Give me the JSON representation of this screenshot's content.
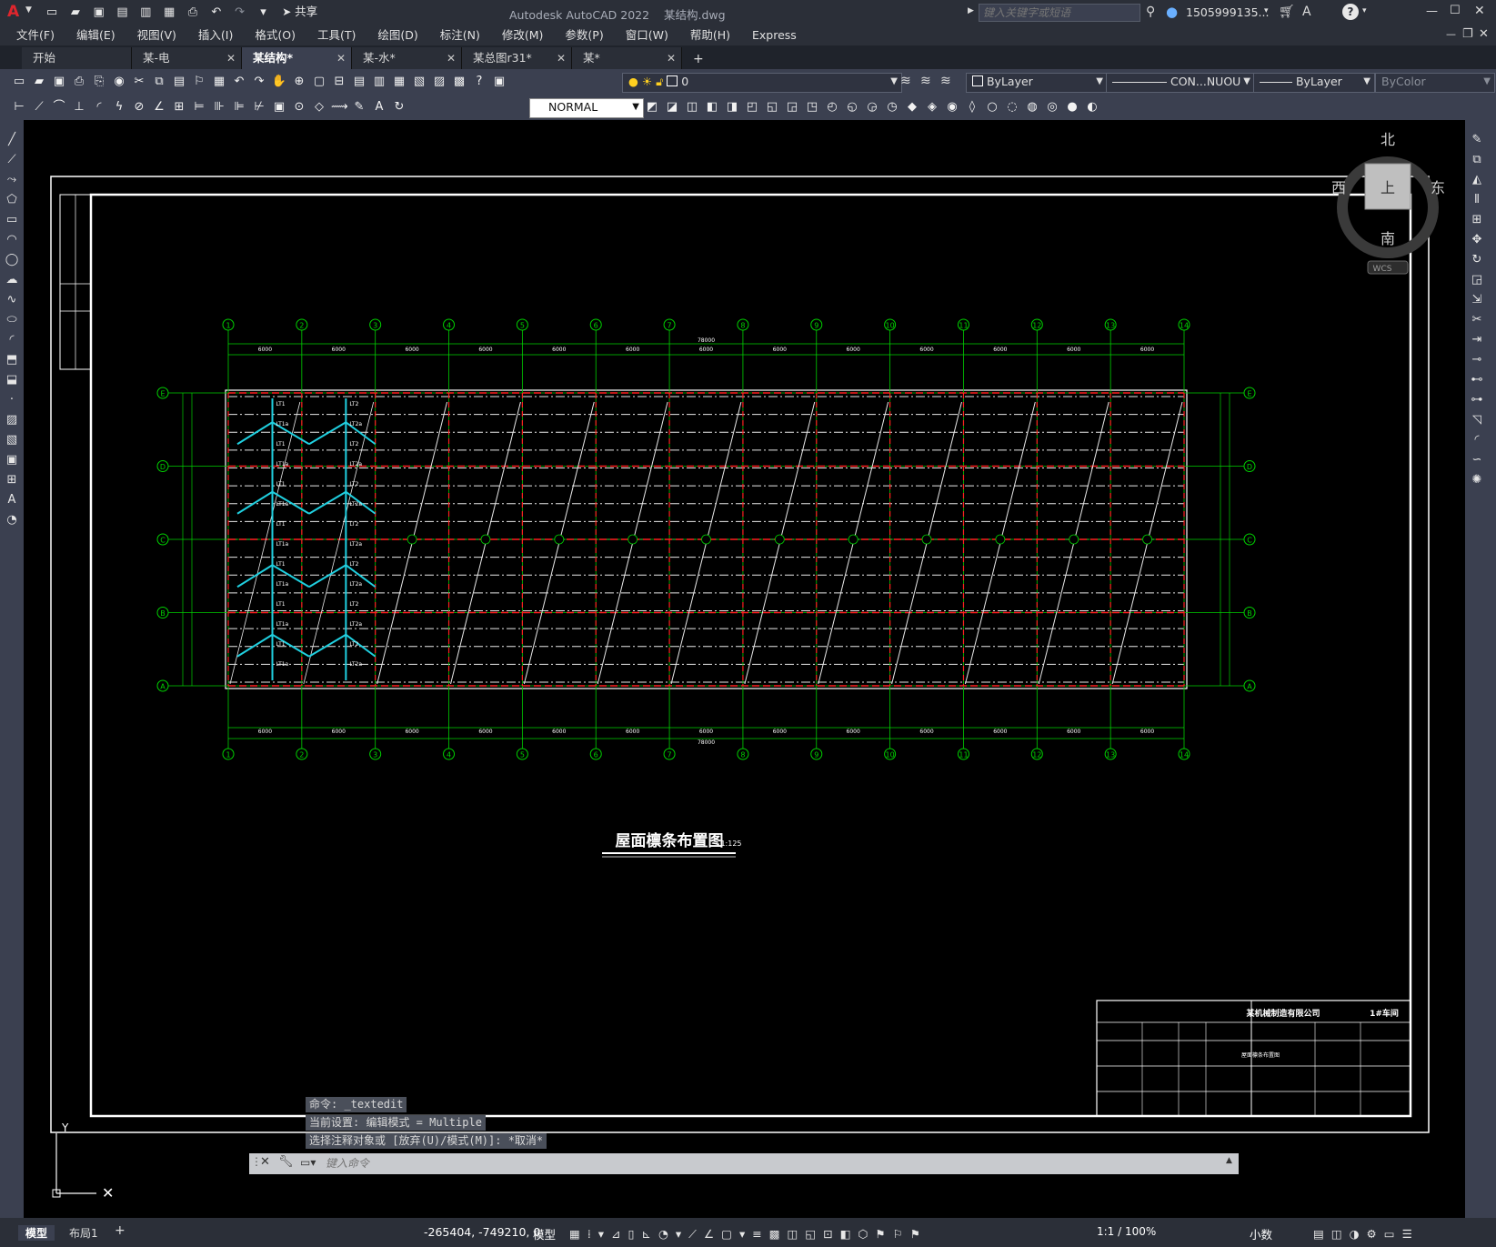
{
  "window": {
    "title": "Autodesk AutoCAD 2022    某结构.dwg",
    "app_icon": "A",
    "share_label": "共享",
    "search_placeholder": "键入关键字或短语",
    "user": "1505999135...",
    "win_controls": [
      "—",
      "☐",
      "✕"
    ],
    "doc_controls": [
      "—",
      "❐",
      "✕"
    ]
  },
  "menu": [
    "文件(F)",
    "编辑(E)",
    "视图(V)",
    "插入(I)",
    "格式(O)",
    "工具(T)",
    "绘图(D)",
    "标注(N)",
    "修改(M)",
    "参数(P)",
    "窗口(W)",
    "帮助(H)",
    "Express"
  ],
  "tabs": [
    {
      "label": "开始",
      "active": false
    },
    {
      "label": "某-电",
      "active": false
    },
    {
      "label": "某结构*",
      "active": true
    },
    {
      "label": "某-水*",
      "active": false
    },
    {
      "label": "某总图r31*",
      "active": false
    },
    {
      "label": "某*",
      "active": false
    }
  ],
  "tab_add": "+",
  "layer_combo": "0",
  "color_combo": "ByLayer",
  "linetype_combo": "CON...NUOU",
  "lineweight_combo": "ByLayer",
  "plotstyle_combo": "ByColor",
  "dimstyle_combo": "NORMAL",
  "viewcube": {
    "north": "北",
    "south": "南",
    "east": "东",
    "west": "西",
    "face": "上",
    "wcs": "WCS"
  },
  "drawing": {
    "title": "屋面檩条布置图",
    "scale": "1:125",
    "total_dim": "78000",
    "bay_dim": "6000",
    "column_axes": [
      "1",
      "2",
      "3",
      "4",
      "5",
      "6",
      "7",
      "8",
      "9",
      "10",
      "11",
      "12",
      "13",
      "14"
    ],
    "row_axes": [
      "E",
      "D",
      "C",
      "B",
      "A"
    ],
    "purlin_labels": [
      "LT1",
      "LT1a",
      "LT2",
      "LT2a"
    ],
    "titleblock": {
      "company": "某机械制造有限公司",
      "project": "1#车间",
      "drawing_name": "屋面檩条布置图"
    }
  },
  "command": {
    "history": [
      "命令: _textedit",
      "当前设置: 编辑模式 = Multiple",
      "选择注释对象或 [放弃(U)/模式(M)]: *取消*"
    ],
    "placeholder": "键入命令"
  },
  "status": {
    "layout_tabs": [
      "模型",
      "布局1"
    ],
    "coords": "-265404, -749210, 0",
    "model_label": "模型",
    "scale": "1:1 / 100%",
    "units": "小数"
  },
  "colors": {
    "grid_green": "#00d000",
    "beam_red": "#ff2020",
    "brace_cyan": "#20d0e0",
    "purlin_white": "#e8e8e8"
  }
}
